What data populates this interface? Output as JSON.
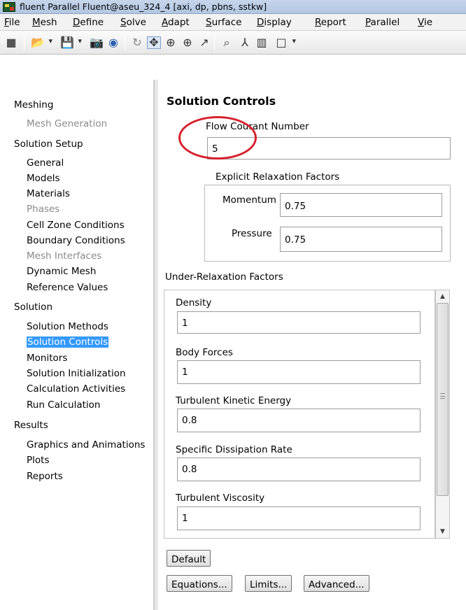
{
  "window": {
    "title": "fluent Parallel Fluent@aseu_324_4  [axi, dp, pbns, sstkw]"
  },
  "menu": [
    "File",
    "Mesh",
    "Define",
    "Solve",
    "Adapt",
    "Surface",
    "Display",
    "Report",
    "Parallel",
    "Vie"
  ],
  "toolbar_icons": [
    "stop-icon",
    "open-icon",
    "save-icon",
    "camera-icon",
    "help-icon",
    "rotate-icon",
    "translate-icon",
    "zoom-fit-icon",
    "zoom-in-icon",
    "probe-icon",
    "zoom-icon",
    "axis-icon",
    "layout-icon",
    "window-icon"
  ],
  "nav": {
    "meshing": "Meshing",
    "mesh_generation": "Mesh Generation",
    "solution_setup": "Solution Setup",
    "general": "General",
    "models": "Models",
    "materials": "Materials",
    "phases": "Phases",
    "cell_zone_conditions": "Cell Zone Conditions",
    "boundary_conditions": "Boundary Conditions",
    "mesh_interfaces": "Mesh Interfaces",
    "dynamic_mesh": "Dynamic Mesh",
    "reference_values": "Reference Values",
    "solution": "Solution",
    "solution_methods": "Solution Methods",
    "solution_controls": "Solution Controls",
    "monitors": "Monitors",
    "solution_initialization": "Solution Initialization",
    "calculation_activities": "Calculation Activities",
    "run_calculation": "Run Calculation",
    "results": "Results",
    "graphics_and_animations": "Graphics and Animations",
    "plots": "Plots",
    "reports": "Reports"
  },
  "panel": {
    "title": "Solution Controls",
    "flow_courant_label": "Flow Courant Number",
    "flow_courant_value": "5",
    "explicit_group": "Explicit Relaxation Factors",
    "momentum_label": "Momentum",
    "momentum_value": "0.75",
    "pressure_label": "Pressure",
    "pressure_value": "0.75",
    "under_relax_group": "Under-Relaxation Factors",
    "density_label": "Density",
    "density_value": "1",
    "body_forces_label": "Body Forces",
    "body_forces_value": "1",
    "tke_label": "Turbulent Kinetic Energy",
    "tke_value": "0.8",
    "sdr_label": "Specific Dissipation Rate",
    "sdr_value": "0.8",
    "tv_label": "Turbulent Viscosity",
    "tv_value": "1",
    "default_button": "Default",
    "equations_button": "Equations...",
    "limits_button": "Limits...",
    "advanced_button": "Advanced..."
  },
  "colors": {
    "selection": "#3399ff",
    "annotation_circle": "#d6212d",
    "disabled_text": "#8a8a8a"
  }
}
